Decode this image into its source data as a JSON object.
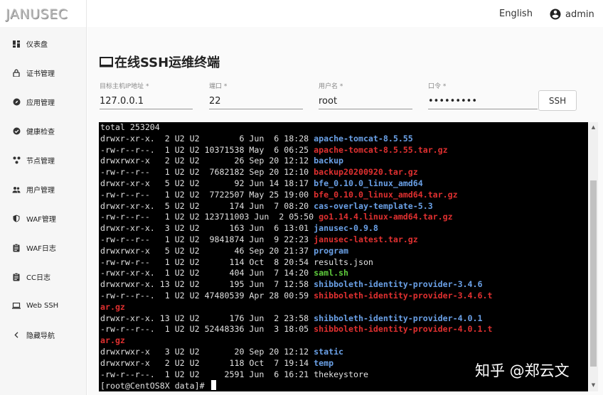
{
  "app": {
    "logo_text": "JANUSEC"
  },
  "header": {
    "language": "English",
    "username": "admin"
  },
  "sidebar": {
    "items": [
      {
        "label": "仪表盘",
        "icon": "dashboard-icon"
      },
      {
        "label": "证书管理",
        "icon": "lock-icon"
      },
      {
        "label": "应用管理",
        "icon": "compass-icon"
      },
      {
        "label": "健康检查",
        "icon": "check-circle-icon"
      },
      {
        "label": "节点管理",
        "icon": "nodes-icon"
      },
      {
        "label": "用户管理",
        "icon": "users-icon"
      },
      {
        "label": "WAF管理",
        "icon": "shield-icon"
      },
      {
        "label": "WAF日志",
        "icon": "clipboard-icon"
      },
      {
        "label": "CC日志",
        "icon": "clipboard-icon"
      },
      {
        "label": "Web SSH",
        "icon": "laptop-icon"
      },
      {
        "label": "隐藏导航",
        "icon": "chevron-left-icon"
      }
    ]
  },
  "page": {
    "title": "在线SSH运维终端",
    "title_icon": "monitor-icon"
  },
  "form": {
    "host": {
      "label": "目标主机IP地址 *",
      "value": "127.0.0.1"
    },
    "port": {
      "label": "端口 *",
      "value": "22"
    },
    "user": {
      "label": "用户名 *",
      "value": "root"
    },
    "password": {
      "label": "口令 *",
      "value": "•••••••••"
    },
    "connect_label": "SSH"
  },
  "terminal": {
    "lines": [
      {
        "meta": "total 253204",
        "name": "",
        "kind": "plain"
      },
      {
        "meta": "drwxr-xr-x.  2 U2 U2        6 Jun  6 18:28 ",
        "name": "apache-tomcat-8.5.55",
        "kind": "dir"
      },
      {
        "meta": "-rw-r--r--.  1 U2 U2 10371538 May  6 06:25 ",
        "name": "apache-tomcat-8.5.55.tar.gz",
        "kind": "archive"
      },
      {
        "meta": "drwxrwxr-x   2 U2 U2       26 Sep 20 12:12 ",
        "name": "backup",
        "kind": "dir"
      },
      {
        "meta": "-rw-r--r--   1 U2 U2  7682182 Sep 20 12:10 ",
        "name": "backup20200920.tar.gz",
        "kind": "archive"
      },
      {
        "meta": "drwxr-xr-x   5 U2 U2       92 Jun 14 18:17 ",
        "name": "bfe_0.10.0_linux_amd64",
        "kind": "dir"
      },
      {
        "meta": "-rw-r--r--   1 U2 U2  7722507 May 25 19:00 ",
        "name": "bfe_0.10.0_linux_amd64.tar.gz",
        "kind": "archive"
      },
      {
        "meta": "drwxr-xr-x.  5 U2 U2      174 Jun  7 08:20 ",
        "name": "cas-overlay-template-5.3",
        "kind": "dir"
      },
      {
        "meta": "-rw-r--r--   1 U2 U2 123711003 Jun  2 05:50 ",
        "name": "go1.14.4.linux-amd64.tar.gz",
        "kind": "archive"
      },
      {
        "meta": "drwxr-xr-x.  3 U2 U2      163 Jun  6 13:01 ",
        "name": "janusec-0.9.8",
        "kind": "dir"
      },
      {
        "meta": "-rw-r--r--   1 U2 U2  9841874 Jun  9 22:23 ",
        "name": "janusec-latest.tar.gz",
        "kind": "archive"
      },
      {
        "meta": "drwxrwxr-x   5 U2 U2       46 Sep 20 21:37 ",
        "name": "program",
        "kind": "dir"
      },
      {
        "meta": "-rw-rw-r--   1 U2 U2      114 Oct  8 20:54 ",
        "name": "results.json",
        "kind": "plain"
      },
      {
        "meta": "-rwxr-xr-x.  1 U2 U2      404 Jun  7 14:20 ",
        "name": "saml.sh",
        "kind": "exec"
      },
      {
        "meta": "drwxrwxr-x. 13 U2 U2      195 Jun  7 12:58 ",
        "name": "shibboleth-identity-provider-3.4.6",
        "kind": "dir"
      },
      {
        "meta": "-rw-r--r--.  1 U2 U2 47480539 Apr 28 00:59 ",
        "name": "shibboleth-identity-provider-3.4.6.t",
        "kind": "archive"
      },
      {
        "meta": "",
        "name": "ar.gz",
        "kind": "archive"
      },
      {
        "meta": "drwxr-xr-x. 13 U2 U2      176 Jun  2 23:58 ",
        "name": "shibboleth-identity-provider-4.0.1",
        "kind": "dir"
      },
      {
        "meta": "-rw-r--r--.  1 U2 U2 52448336 Jun  3 18:05 ",
        "name": "shibboleth-identity-provider-4.0.1.t",
        "kind": "archive"
      },
      {
        "meta": "",
        "name": "ar.gz",
        "kind": "archive"
      },
      {
        "meta": "drwxrwxr-x   3 U2 U2       20 Sep 20 12:12 ",
        "name": "static",
        "kind": "dir"
      },
      {
        "meta": "drwxrwxr-x   2 U2 U2      118 Oct  7 19:14 ",
        "name": "temp",
        "kind": "dir"
      },
      {
        "meta": "-rw-r--r--.  1 U2 U2     2591 Jun  6 16:21 ",
        "name": "thekeystore",
        "kind": "plain"
      }
    ],
    "prompt": "[root@CentOS8X data]# "
  },
  "watermark": "知乎 @郑云文",
  "colors": {
    "dir": "#6aa0e6",
    "archive": "#e03030",
    "exec": "#5ecb3c",
    "terminal_bg": "#000000"
  }
}
